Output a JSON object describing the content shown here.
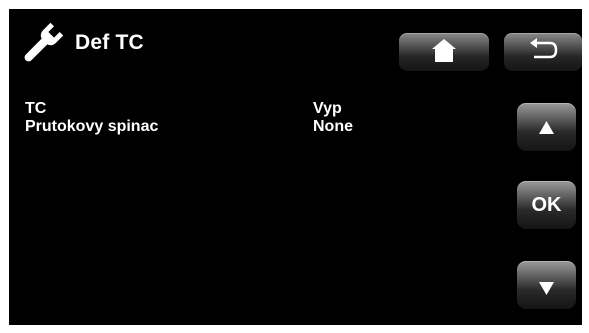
{
  "header": {
    "title": "Def TC",
    "title_icon": "wrench-icon",
    "home_button_icon": "home-icon",
    "back_button_icon": "back-arrow-icon"
  },
  "settings": [
    {
      "label": "TC",
      "value": "Vyp"
    },
    {
      "label": "Prutokovy spinac",
      "value": "None"
    }
  ],
  "side_controls": {
    "up_icon": "triangle-up-icon",
    "ok_label": "OK",
    "down_icon": "triangle-down-icon"
  },
  "colors": {
    "background": "#000000",
    "text": "#ffffff",
    "button_top": "#9a9a9a",
    "button_bottom": "#141414"
  }
}
